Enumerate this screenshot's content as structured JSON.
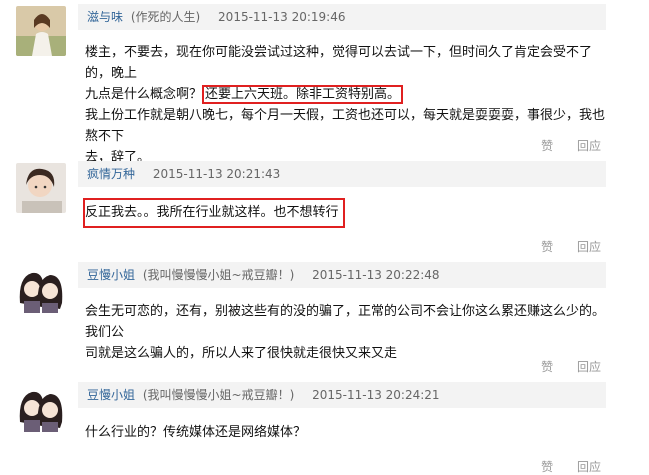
{
  "comments": [
    {
      "user": "滋与味",
      "note": "(作死的人生)",
      "time": "2015-11-13 20:19:46",
      "line1": "楼主，不要去，现在你可能没尝试过这种，觉得可以去试一下，但时间久了肯定会受不了的，晚上",
      "line2_pre": "九点是什么概念啊？",
      "line2_hl": "还要上六天班。除非工资特别高。",
      "line3": "我上份工作就是朝八晚七，每个月一天假，工资也还可以，每天就是耍耍耍，事很少，我也熬不下",
      "line4": "去，辞了。",
      "like": "赞",
      "reply": "回应"
    },
    {
      "user": "疯情万种",
      "time": "2015-11-13 20:21:43",
      "text_hl": "反正我去。。我所在行业就这样。也不想转行",
      "like": "赞",
      "reply": "回应"
    },
    {
      "user": "豆慢小姐",
      "note": "(我叫慢慢慢小姐~戒豆瓣！)",
      "time": "2015-11-13 20:22:48",
      "line1": "会生无可恋的，还有，别被这些有的没的骗了，正常的公司不会让你这么累还赚这么少的。我们公",
      "line2": "司就是这么骗人的，所以人来了很快就走很快又来又走",
      "like": "赞",
      "reply": "回应"
    },
    {
      "user": "豆慢小姐",
      "note": "(我叫慢慢慢小姐~戒豆瓣！)",
      "time": "2015-11-13 20:24:21",
      "line1": "什么行业的？传统媒体还是网络媒体？",
      "like": "赞",
      "reply": "回应"
    }
  ]
}
